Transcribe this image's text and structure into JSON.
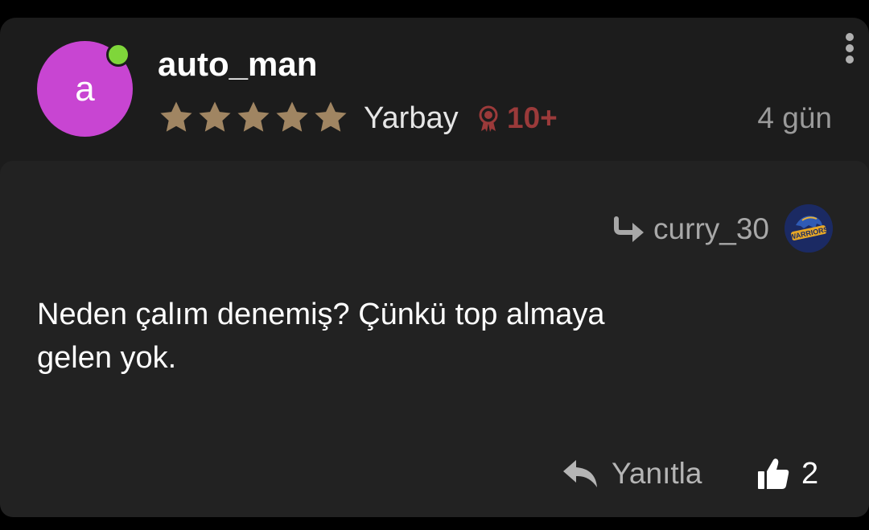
{
  "comment": {
    "author": {
      "username": "auto_man",
      "avatar_letter": "a",
      "avatar_color": "#c845d2",
      "online": true,
      "online_color": "#7fd63a",
      "star_rating": 5,
      "rank": "Yarbay",
      "points": "10+",
      "points_color": "#9b3a3a"
    },
    "time_ago": "4 gün",
    "reply_to": {
      "username": "curry_30",
      "avatar_text": "WARRIORS",
      "icon": "reply-arrow-icon"
    },
    "text_line1": "Neden çalım denemiş? Çünkü top almaya",
    "text_line2": "gelen yok.",
    "actions": {
      "reply_label": "Yanıtla",
      "like_count": "2"
    },
    "icons": {
      "star": "star-icon",
      "medal": "medal-icon",
      "more": "more-vertical-icon",
      "reply": "reply-icon",
      "like": "thumbs-up-icon"
    }
  }
}
